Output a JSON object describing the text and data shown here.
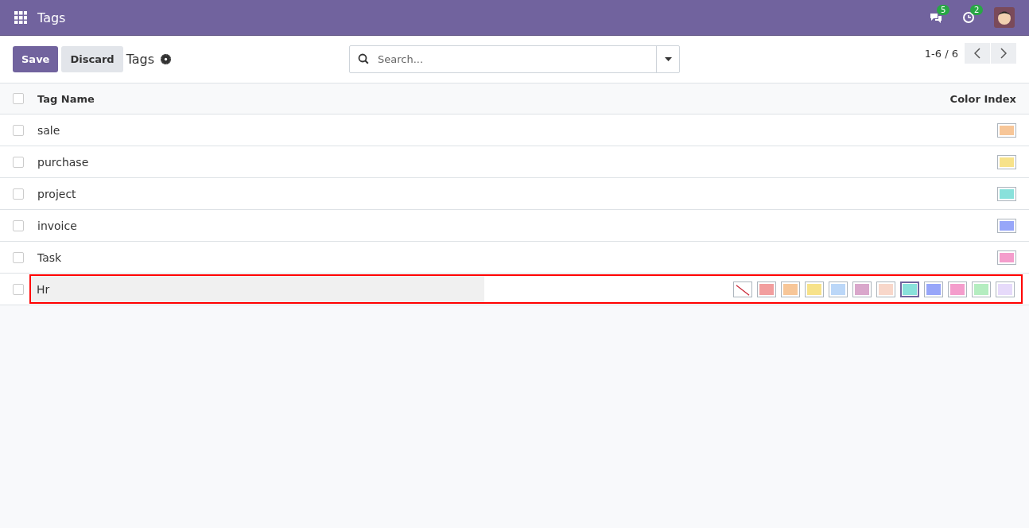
{
  "navbar": {
    "title": "Tags",
    "messages_badge": "5",
    "activities_badge": "2"
  },
  "control_panel": {
    "buttons": [
      "Save",
      "Discard"
    ],
    "breadcrumb": "Tags",
    "search": {
      "placeholder": "Search..."
    },
    "pager": "1-6 / 6"
  },
  "table": {
    "select_all_checked": false,
    "columns": [
      "Tag Name",
      "Color Index"
    ],
    "rows": [
      {
        "checked": false,
        "name": "sale",
        "color": "#f7c698"
      },
      {
        "checked": false,
        "name": "purchase",
        "color": "#f7e28a"
      },
      {
        "checked": false,
        "name": "project",
        "color": "#89e1db"
      },
      {
        "checked": false,
        "name": "invoice",
        "color": "#97a6f9"
      },
      {
        "checked": false,
        "name": "Task",
        "color": "#f49dcc"
      }
    ],
    "editing_row": {
      "checked": false,
      "name": "Hr",
      "swatches": [
        {
          "kind": "none",
          "selected": false
        },
        {
          "kind": "color",
          "color": "#f29e9e",
          "selected": false
        },
        {
          "kind": "color",
          "color": "#f7c698",
          "selected": false
        },
        {
          "kind": "color",
          "color": "#f7e28a",
          "selected": false
        },
        {
          "kind": "color",
          "color": "#bbd7f8",
          "selected": false
        },
        {
          "kind": "color",
          "color": "#d9a7cb",
          "selected": false
        },
        {
          "kind": "color",
          "color": "#f8d7ca",
          "selected": false
        },
        {
          "kind": "color",
          "color": "#89e1db",
          "selected": true
        },
        {
          "kind": "color",
          "color": "#97a6f9",
          "selected": false
        },
        {
          "kind": "color",
          "color": "#f49dcc",
          "selected": false
        },
        {
          "kind": "color",
          "color": "#b4edc0",
          "selected": false
        },
        {
          "kind": "color",
          "color": "#e6dafa",
          "selected": false
        }
      ]
    }
  }
}
